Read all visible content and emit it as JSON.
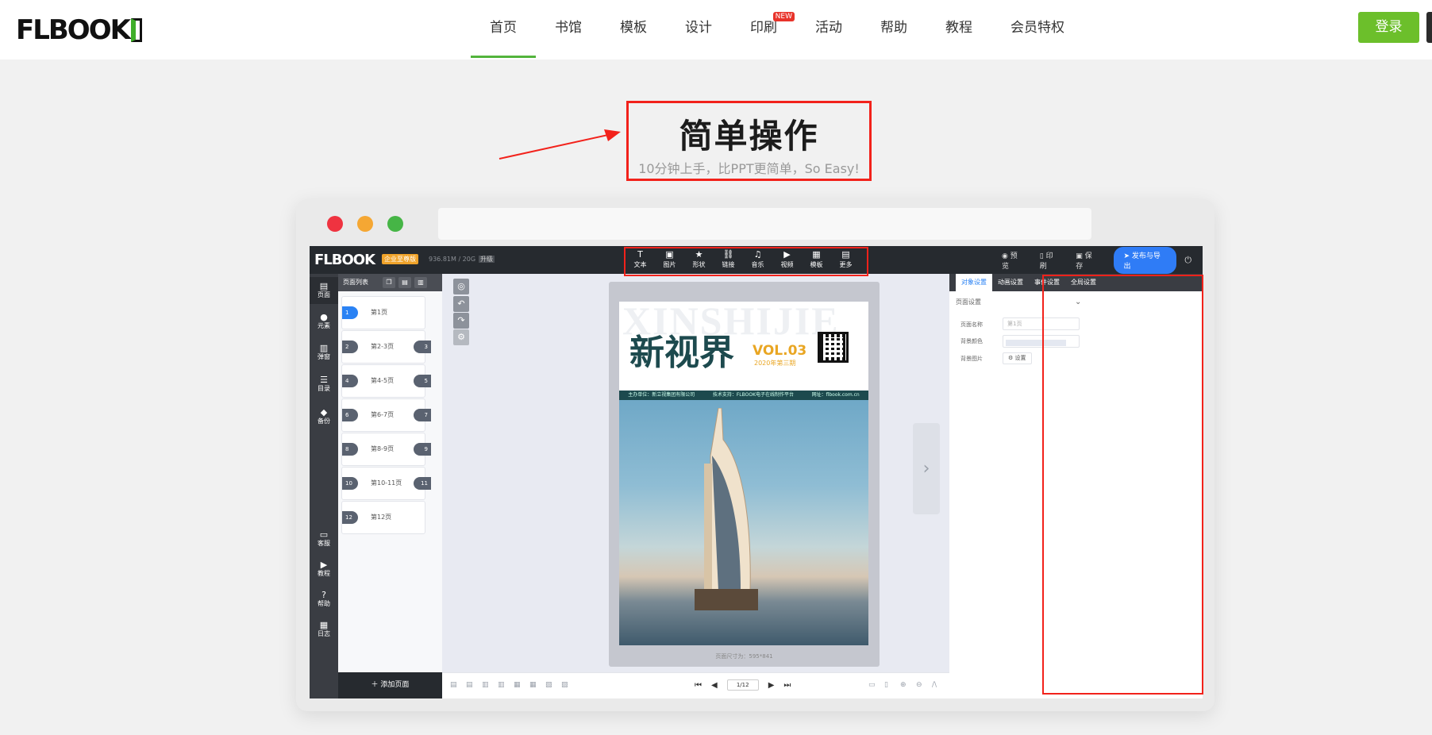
{
  "site": {
    "logo": "FLBOOK",
    "nav": [
      {
        "label": "首页",
        "active": true
      },
      {
        "label": "书馆"
      },
      {
        "label": "模板"
      },
      {
        "label": "设计"
      },
      {
        "label": "印刷",
        "badge": "NEW"
      },
      {
        "label": "活动"
      },
      {
        "label": "帮助"
      },
      {
        "label": "教程"
      },
      {
        "label": "会员特权"
      }
    ],
    "login": "登录",
    "accent": "#6cbf2b"
  },
  "hero": {
    "title": "简单操作",
    "subtitle": "10分钟上手，比PPT更简单，So Easy!"
  },
  "editor": {
    "logo": "FLBOOK",
    "edition": "企业至尊版",
    "storage": "936.81M / 20G",
    "upgrade": "升级",
    "tools": [
      {
        "icon": "T",
        "label": "文本"
      },
      {
        "icon": "▣",
        "label": "图片"
      },
      {
        "icon": "★",
        "label": "形状"
      },
      {
        "icon": "⛓",
        "label": "链接"
      },
      {
        "icon": "♫",
        "label": "音乐"
      },
      {
        "icon": "▶",
        "label": "视频"
      },
      {
        "icon": "▦",
        "label": "模板"
      },
      {
        "icon": "▤",
        "label": "更多"
      }
    ],
    "top_actions": {
      "preview": "预览",
      "print": "印刷",
      "save": "保存",
      "publish": "发布与导出"
    },
    "sidebar": [
      {
        "icon": "▤",
        "label": "页面"
      },
      {
        "icon": "●",
        "label": "元素"
      },
      {
        "icon": "▥",
        "label": "弹窗"
      },
      {
        "icon": "☰",
        "label": "目录"
      },
      {
        "icon": "◆",
        "label": "备份"
      },
      {
        "icon": "▭",
        "label": "客服"
      },
      {
        "icon": "▶",
        "label": "教程"
      },
      {
        "icon": "?",
        "label": "帮助"
      },
      {
        "icon": "▦",
        "label": "日志"
      }
    ],
    "page_list": {
      "title": "页面列表",
      "add": "添加页面",
      "pages": [
        {
          "left": "1",
          "label": "第1页",
          "right": ""
        },
        {
          "left": "2",
          "label": "第2-3页",
          "right": "3"
        },
        {
          "left": "4",
          "label": "第4-5页",
          "right": "5"
        },
        {
          "left": "6",
          "label": "第6-7页",
          "right": "7"
        },
        {
          "left": "8",
          "label": "第8-9页",
          "right": "9"
        },
        {
          "left": "10",
          "label": "第10-11页",
          "right": "11"
        },
        {
          "left": "12",
          "label": "第12页",
          "right": ""
        }
      ]
    },
    "doc": {
      "ghost": "XINSHIJIE",
      "title": "新视界",
      "vol": "VOL.03",
      "issue": "2020年第三期",
      "bar": [
        "主办单位：新立视集团有限公司",
        "技术支持：FLBOOK电子在线制作平台",
        "网址：flbook.com.cn"
      ],
      "size": "页面尺寸为：595*841"
    },
    "right_panel": {
      "tabs": [
        "对象设置",
        "动画设置",
        "事件设置",
        "全局设置"
      ],
      "section": "页面设置",
      "fields": {
        "name_label": "页面名称",
        "name_placeholder": "第1页",
        "bg_color_label": "背景颜色",
        "bg_image_label": "背景图片",
        "set_button": "设置"
      }
    },
    "pager": {
      "current": "1/12"
    }
  }
}
